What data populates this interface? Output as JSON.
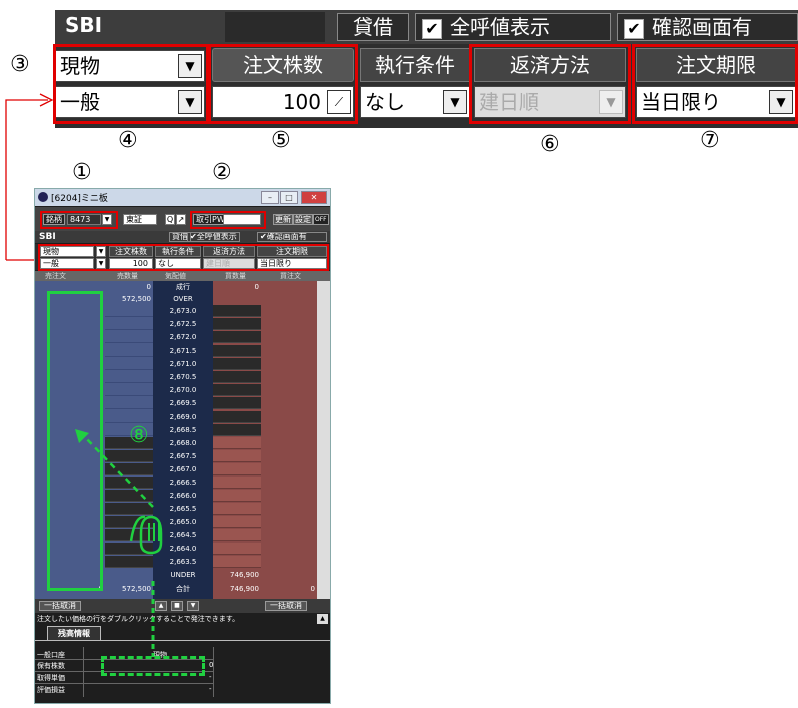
{
  "zoom": {
    "brand": "SBI",
    "btn_taishaku": "貸借",
    "chk_all_price": "全呼値表示",
    "chk_confirm": "確認画面有",
    "check_mark": "✔",
    "account_type": "現物",
    "credit_type": "一般",
    "qty_header": "注文株数",
    "qty_value": "100",
    "exec_header": "執行条件",
    "exec_value": "なし",
    "repay_header": "返済方法",
    "repay_value": "建日順",
    "term_header": "注文期限",
    "term_value": "当日限り",
    "dropdown_glyph": "▼"
  },
  "markers": {
    "m1": "①",
    "m2": "②",
    "m3": "③",
    "m4": "④",
    "m5": "⑤",
    "m6": "⑥",
    "m7": "⑦",
    "m8": "⑧"
  },
  "window": {
    "title": "[6204]ミニ板",
    "sym_label": "銘柄",
    "sym_code": "8473",
    "market": "東証",
    "pw_label": "取引PW",
    "update": "更新",
    "settings": "設定",
    "off": "OFF",
    "brand": "SBI",
    "taishaku": "貸借",
    "all_price": "全呼値表示",
    "confirm": "確認画面有",
    "account": "現物",
    "credit": "一般",
    "qty_h": "注文株数",
    "qty": "100",
    "exec_h": "執行条件",
    "exec": "なし",
    "repay_h": "返済方法",
    "repay": "建日順",
    "term_h": "注文期限",
    "term": "当日限り",
    "col_buy_order": "売注文",
    "col_sell_qty": "売数量",
    "col_price": "気配値",
    "col_buy_qty": "買数量",
    "col_buy": "買注文",
    "market_order": "成行",
    "mkt_sell_qty": "0",
    "mkt_buy_qty": "0",
    "over": "OVER",
    "over_qty": "572,500",
    "prices": [
      "2,673.0",
      "2,672.5",
      "2,672.0",
      "2,671.5",
      "2,671.0",
      "2,670.5",
      "2,670.0",
      "2,669.5",
      "2,669.0",
      "2,668.5",
      "2,668.0",
      "2,667.5",
      "2,667.0",
      "2,666.5",
      "2,666.0",
      "2,665.5",
      "2,665.0",
      "2,664.5",
      "2,664.0",
      "2,663.5"
    ],
    "under": "UNDER",
    "under_qty": "746,900",
    "total_label": "合計",
    "total_left0": "0",
    "total_sell": "572,500",
    "total_buy": "746,900",
    "total_right0": "0",
    "cancel_all_left": "一括取消",
    "cancel_all_right": "一括取消",
    "hint": "注文したい価格の行をダブルクリックすることで発注できます。",
    "tab_zandaka": "残高情報",
    "acct_label": "一般口座",
    "genbutsu": "現物",
    "holding_label": "保有株数",
    "holding_value": "0",
    "cost_label": "取得単価",
    "cost_value": "-",
    "pl_label": "評価損益",
    "pl_value": "-"
  }
}
